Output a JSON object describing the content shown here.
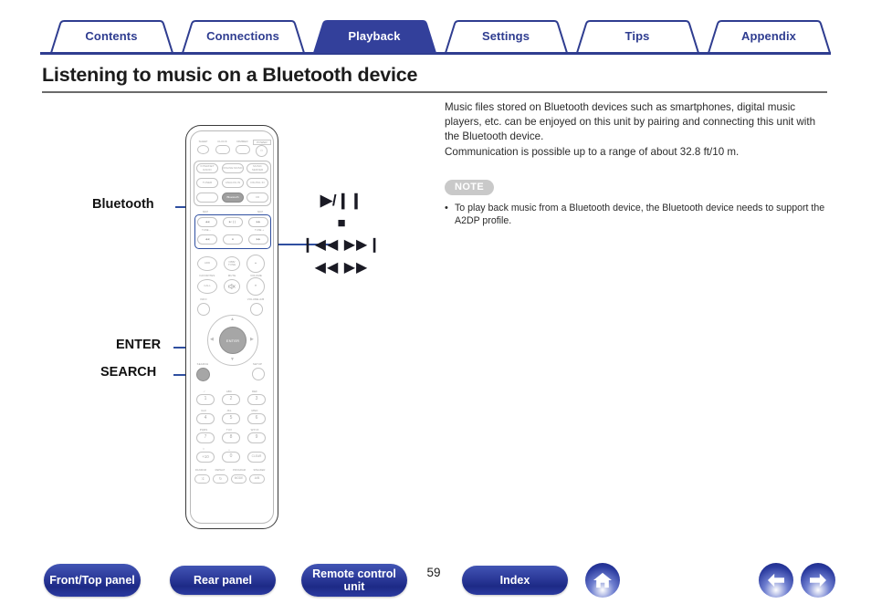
{
  "nav": {
    "tabs": [
      {
        "label": "Contents",
        "active": false
      },
      {
        "label": "Connections",
        "active": false
      },
      {
        "label": "Playback",
        "active": true
      },
      {
        "label": "Settings",
        "active": false
      },
      {
        "label": "Tips",
        "active": false
      },
      {
        "label": "Appendix",
        "active": false
      }
    ],
    "active_tab_color": "#33409b",
    "tab_text_color": "#2f3d90"
  },
  "page": {
    "title": "Listening to music on a Bluetooth device",
    "number": "59"
  },
  "intro": {
    "paragraph1": "Music files stored on Bluetooth devices such as smartphones, digital music players, etc. can be enjoyed on this unit by pairing and connecting this unit with the Bluetooth device.",
    "paragraph2": "Communication is possible up to a range of about 32.8 ft/10 m."
  },
  "note": {
    "badge": "NOTE",
    "bullet": "•",
    "items": [
      "To play back music from a Bluetooth device, the Bluetooth device needs to support the A2DP profile."
    ]
  },
  "callouts": {
    "bluetooth": "Bluetooth",
    "enter": "ENTER",
    "search": "SEARCH"
  },
  "glyphs": {
    "play_pause": "▶/❙❙",
    "stop": "■",
    "skip": "❙◀◀  ▶▶❙",
    "scan": "◀◀  ▶▶"
  },
  "remote": {
    "row_top_labels": [
      "SLEEP",
      "CLOCK",
      "DIMMER",
      "POWER"
    ],
    "power_icon": "⏻",
    "source_buttons": [
      {
        "label": "INTERNET RADIO",
        "highlight": false
      },
      {
        "label": "ONLINE MUSIC",
        "highlight": false
      },
      {
        "label": "MUSIC SERVER",
        "highlight": false
      },
      {
        "label": "TUNER",
        "highlight": false
      },
      {
        "label": "ANALOG IN",
        "highlight": false
      },
      {
        "label": "DIGITAL IN",
        "highlight": false
      },
      {
        "label": "Bluetooth",
        "highlight": true
      },
      {
        "label": "CD",
        "highlight": false
      }
    ],
    "transport_top_labels": [
      "SKIP",
      "SKIP"
    ],
    "transport": [
      {
        "glyph": "◀◀"
      },
      {
        "glyph": "▶/❙❙"
      },
      {
        "glyph": "▶▶"
      }
    ],
    "transport_mid_labels": [
      "TUNE –",
      "TUNE +"
    ],
    "transport2": [
      {
        "glyph": "◀◀"
      },
      {
        "glyph": "■"
      },
      {
        "glyph": "▶▶"
      }
    ],
    "mid_buttons": [
      {
        "label": "ADD"
      },
      {
        "label": "DBB/ TONE"
      },
      {
        "label": "▲"
      }
    ],
    "mid_labels": [
      "FAVORITES",
      "MUTE",
      "VOLUME"
    ],
    "mid_buttons2": [
      {
        "label": "CALL"
      },
      {
        "label": "ὐ7"
      },
      {
        "label": "▼"
      }
    ],
    "info_label": "INFO",
    "volume_ab_label": "VOLUME A/B",
    "nav_arrows": [
      "▲",
      "◀",
      "▶",
      "▼"
    ],
    "enter_label": "ENTER",
    "search_label": "SEARCH",
    "setup_label": "SETUP",
    "keypad_letters": [
      ". /",
      "ABC",
      "DEF",
      "GHI",
      "JKL",
      "MNO",
      "PQRS",
      "TUV",
      "WXYZ",
      "☆",
      "␣",
      ""
    ],
    "keypad": [
      "1",
      "2",
      "3",
      "4",
      "5",
      "6",
      "7",
      "8",
      "9",
      "+10",
      "0",
      "CLEAR"
    ],
    "bottom_labels": [
      "RANDOM",
      "REPEAT",
      "PROGRAM",
      "SPEAKER"
    ],
    "bottom_buttons": [
      "⤨",
      "↻",
      "MODE",
      "A/B"
    ]
  },
  "footer": {
    "buttons": [
      {
        "label": "Front/Top panel"
      },
      {
        "label": "Rear panel"
      },
      {
        "label": "Remote control unit"
      },
      {
        "label": "Index"
      }
    ],
    "home_icon": "home-icon",
    "prev_icon": "arrow-left-icon",
    "next_icon": "arrow-right-icon"
  }
}
